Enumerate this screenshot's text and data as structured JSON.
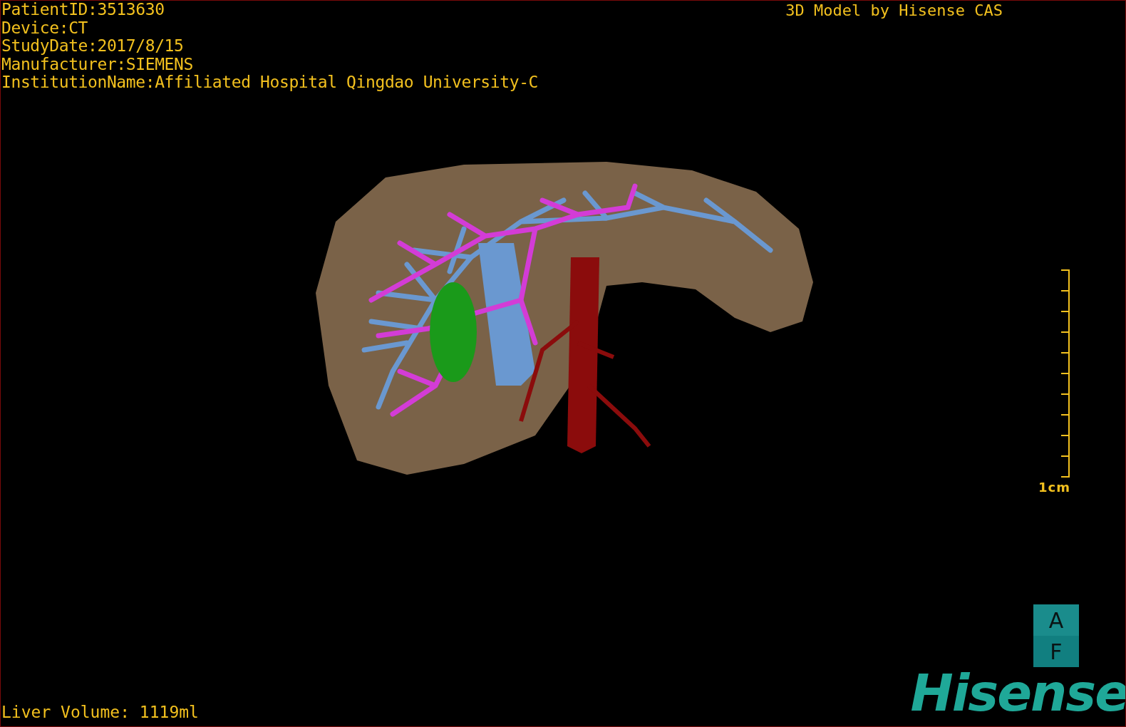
{
  "patient_info": [
    "PatientID:3513630",
    "Device:CT",
    "StudyDate:2017/8/15",
    "Manufacturer:SIEMENS",
    "InstitutionName:Affiliated Hospital Qingdao University-C"
  ],
  "title": "3D Model by Hisense CAS",
  "scale_bar": {
    "label": "1cm"
  },
  "orientation_cube": {
    "top": "A",
    "bottom": "F"
  },
  "logo": "Hisense",
  "liver_volume": "Liver Volume: 1119ml"
}
